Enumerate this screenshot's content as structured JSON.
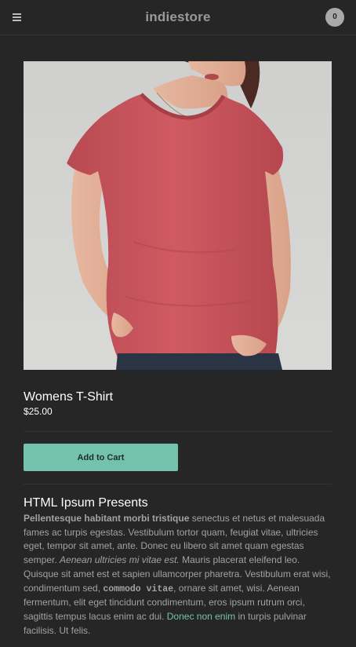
{
  "header": {
    "menu_icon": "hamburger-menu-icon",
    "title": "indiestore",
    "cart_count": "0"
  },
  "product": {
    "image_subject": "woman-wearing-red-tshirt",
    "title": "Womens T-Shirt",
    "price": "$25.00",
    "add_to_cart_label": "Add to Cart"
  },
  "description": {
    "heading": "HTML Ipsum Presents",
    "strong": "Pellentesque habitant morbi tristique",
    "text_1": " senectus et netus et malesuada fames ac turpis egestas. Vestibulum tortor quam, feugiat vitae, ultricies eget, tempor sit amet, ante. Donec eu libero sit amet quam egestas semper. ",
    "em": "Aenean ultricies mi vitae est.",
    "text_2": " Mauris placerat eleifend leo. Quisque sit amet est et sapien ullamcorper pharetra. Vestibulum erat wisi, condimentum sed, ",
    "code": "commodo vitae",
    "text_3": ", ornare sit amet, wisi. Aenean fermentum, elit eget tincidunt condimentum, eros ipsum rutrum orci, sagittis tempus lacus enim ac dui. ",
    "link": "Donec non enim",
    "text_4": " in turpis pulvinar facilisis. Ut felis."
  },
  "colors": {
    "background": "#262626",
    "accent": "#75c2ac",
    "body_text": "#a2a2a2",
    "shirt": "#c9555c"
  }
}
